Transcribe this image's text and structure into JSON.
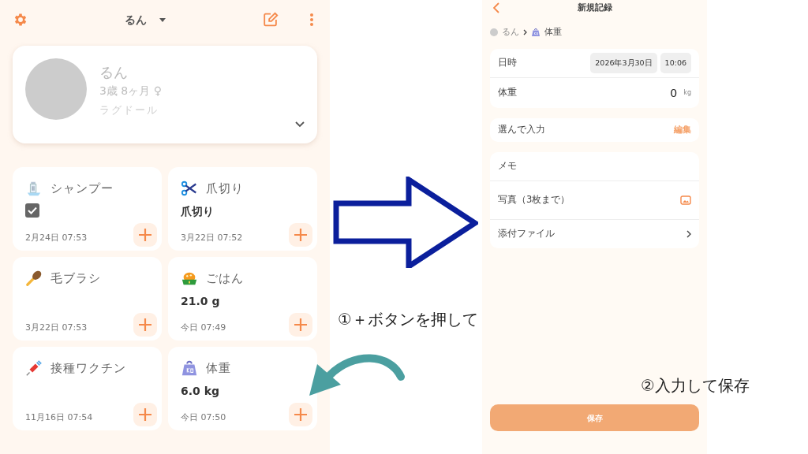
{
  "left_screen": {
    "header": {
      "pet_name": "るん"
    },
    "profile": {
      "name": "るん",
      "age": "3歳 8ヶ月 ♀",
      "breed": "ラグドール"
    },
    "records": [
      {
        "kind": "shampoo",
        "title": "シャンプー",
        "checked": true,
        "date": "2月24日 07:53"
      },
      {
        "kind": "nails",
        "title": "爪切り",
        "value": "爪切り",
        "date": "3月22日 07:52"
      },
      {
        "kind": "brush",
        "title": "毛ブラシ",
        "date": "3月22日 07:53"
      },
      {
        "kind": "food",
        "title": "ごはん",
        "value": "21.0 g",
        "date": "今日 07:49"
      },
      {
        "kind": "vaccine",
        "title": "接種ワクチン",
        "date": "11月16日 07:54"
      },
      {
        "kind": "weight",
        "title": "体重",
        "value": "6.0 kg",
        "date": "今日 07:50"
      }
    ]
  },
  "right_screen": {
    "title": "新規記録",
    "breadcrumb": {
      "pet": "るん",
      "record": "体重"
    },
    "groups": [
      [
        {
          "kind": "datetime",
          "label": "日時",
          "date": "2026年3月30日",
          "time": "10:06"
        },
        {
          "kind": "number",
          "label": "体重",
          "value": "0",
          "unit": "kg"
        }
      ],
      [
        {
          "kind": "action",
          "label": "選んで入力",
          "action": "編集"
        }
      ],
      [
        {
          "kind": "plain",
          "label": "メモ"
        },
        {
          "kind": "photo",
          "label": "写真（3枚まで）"
        },
        {
          "kind": "link",
          "label": "添付ファイル"
        }
      ]
    ],
    "save_button": "保存"
  },
  "annotations": {
    "step_1": "①＋ボタンを押して",
    "step_2": "②入力して保存"
  }
}
